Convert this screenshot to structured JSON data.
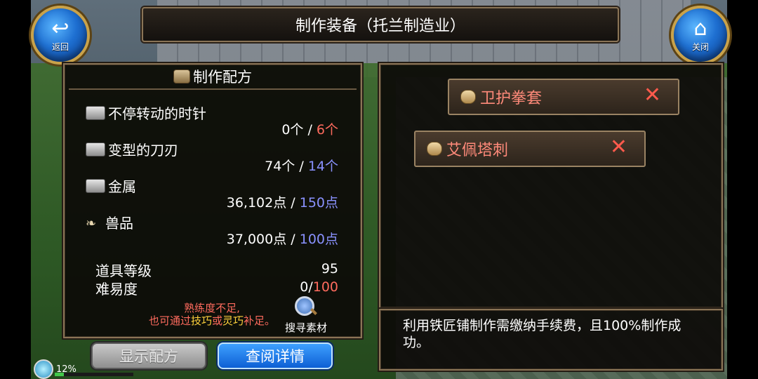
{
  "title": "制作装备（托兰制造业）",
  "back_button": {
    "label": "返回",
    "icon": "back-arrow-icon"
  },
  "close_button": {
    "label": "关闭",
    "icon": "home-icon"
  },
  "recipe": {
    "header": "制作配方",
    "materials": [
      {
        "name": "不停转动的时针",
        "have": "0个",
        "need": "6个",
        "need_color": "#ff6b5e",
        "icon": "ingot-icon"
      },
      {
        "name": "变型的刀刃",
        "have": "74个",
        "need": "14个",
        "need_color": "#8a92ff",
        "icon": "ingot-icon"
      },
      {
        "name": "金属",
        "have": "36,102点",
        "need": "150点",
        "need_color": "#8a92ff",
        "icon": "ingot-icon"
      },
      {
        "name": "兽品",
        "have": "37,000点",
        "need": "100点",
        "need_color": "#8a92ff",
        "icon": "fang-icon"
      }
    ],
    "item_level_label": "道具等级",
    "item_level_value": "95",
    "difficulty_label": "难易度",
    "difficulty_have": "0",
    "difficulty_max": "100",
    "warning_line1": "熟练度不足,",
    "warning_line2_prefix": "也可通过",
    "warning_skill": "技巧",
    "warning_or": "或",
    "warning_dex": "灵巧",
    "warning_suffix": "补足。",
    "search_label": "搜寻素材"
  },
  "buttons": {
    "show_recipe": "显示配方",
    "view_detail": "查阅详情"
  },
  "results": [
    {
      "name": "卫护拳套",
      "remove": "✕"
    },
    {
      "name": "艾佩塔刺",
      "remove": "✕"
    }
  ],
  "description": "利用铁匠铺制作需缴纳手续费，且100%制作成功。",
  "status": {
    "percent_text": "12%",
    "exp_fraction": 0.12
  }
}
